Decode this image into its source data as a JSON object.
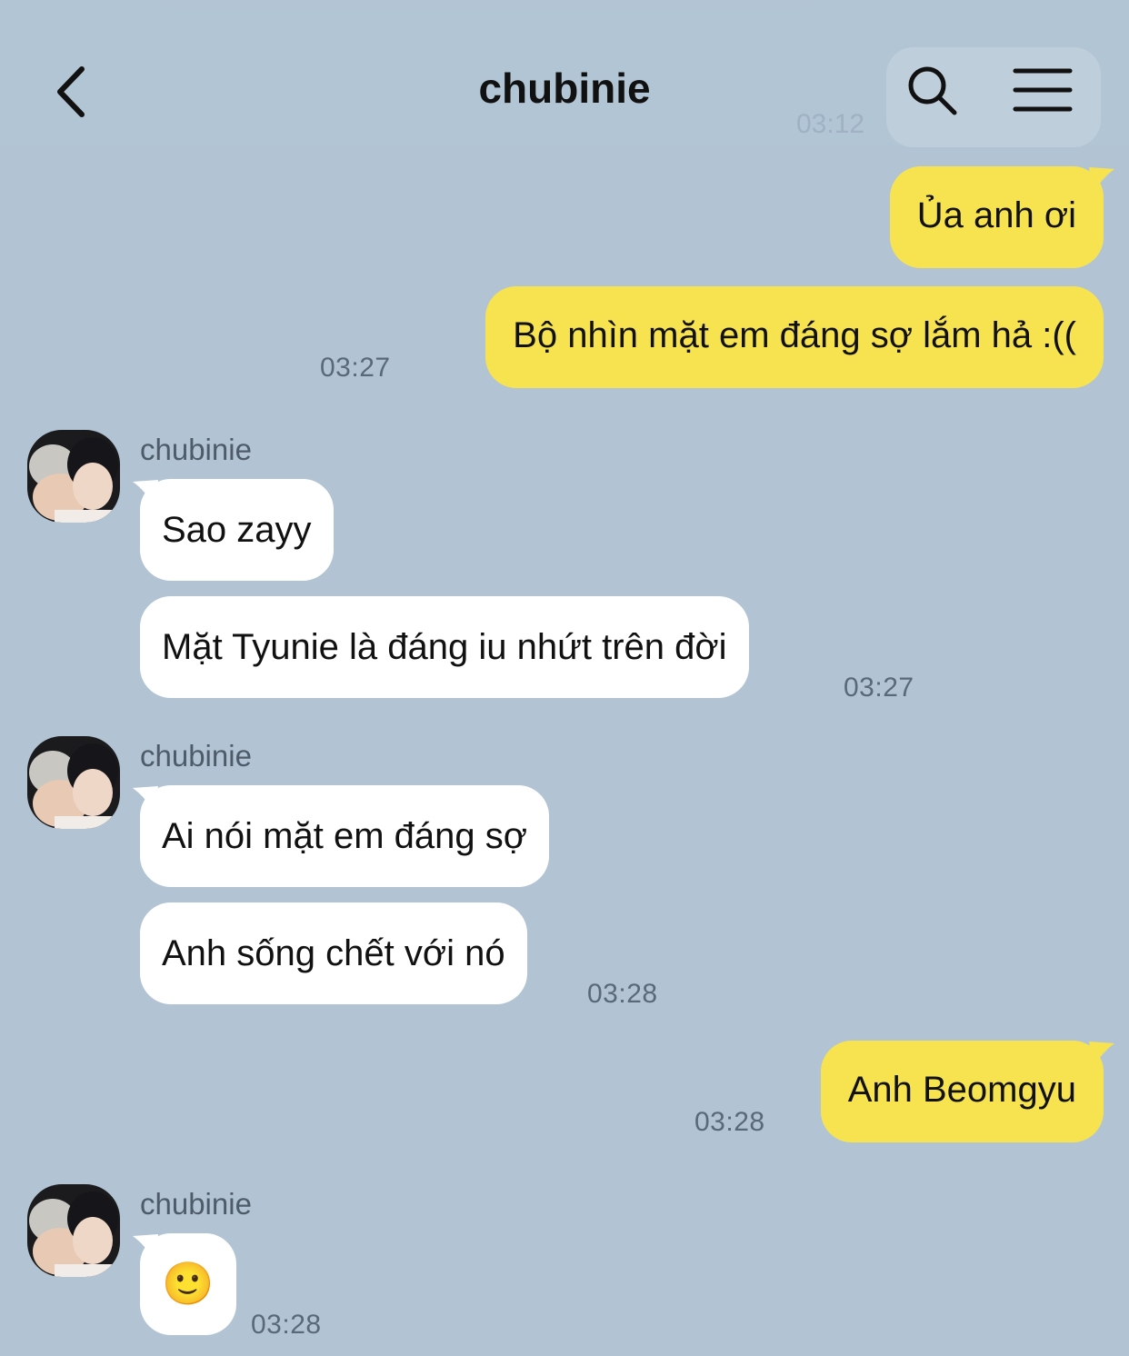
{
  "header": {
    "title": "chubinie",
    "ghost_time": "03:12"
  },
  "colors": {
    "background": "#b2c4d4",
    "outgoing_bubble": "#f7e350",
    "incoming_bubble": "#ffffff"
  },
  "messages": [
    {
      "dir": "out",
      "text": "Ủa anh ơi"
    },
    {
      "dir": "out",
      "text": "Bộ nhìn mặt em đáng sợ lắm hả :((",
      "time": "03:27"
    },
    {
      "dir": "in",
      "sender": "chubinie",
      "text": "Sao zayy"
    },
    {
      "dir": "in",
      "text": "Mặt Tyunie là đáng iu nhứt trên đời",
      "time": "03:27"
    },
    {
      "dir": "in",
      "sender": "chubinie",
      "text": "Ai nói mặt em đáng sợ"
    },
    {
      "dir": "in",
      "text": "Anh sống chết với nó",
      "time": "03:28"
    },
    {
      "dir": "out",
      "text": "Anh Beomgyu",
      "time": "03:28"
    },
    {
      "dir": "in",
      "sender": "chubinie",
      "text": "🙂",
      "time": "03:28"
    }
  ]
}
